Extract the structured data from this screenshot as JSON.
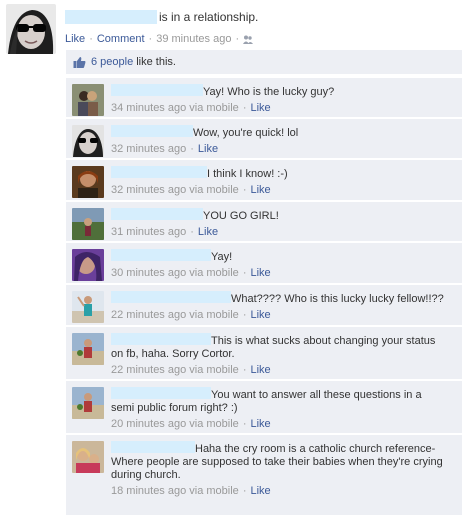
{
  "story": {
    "status_text": "is in a relationship.",
    "actions": {
      "like": "Like",
      "comment": "Comment",
      "time": "39 minutes ago"
    },
    "icons": {
      "avatar": "woman-in-sunglasses-avatar",
      "audience": "people-icon"
    },
    "likes": {
      "icon": "thumbs-up-icon",
      "count_label": "6 people",
      "suffix": "like this."
    }
  },
  "comments": [
    {
      "text": "Yay! Who is the lucky guy?",
      "time": "34 minutes ago",
      "via": "via mobile",
      "like": "Like",
      "mobile": true
    },
    {
      "text": "Wow, you're quick! lol",
      "time": "32 minutes ago",
      "via": "",
      "like": "Like",
      "mobile": false
    },
    {
      "text": "I think I know! :-)",
      "time": "32 minutes ago",
      "via": "via mobile",
      "like": "Like",
      "mobile": true
    },
    {
      "text": "YOU GO GIRL!",
      "time": "31 minutes ago",
      "via": "",
      "like": "Like",
      "mobile": false
    },
    {
      "text": "Yay!",
      "time": "30 minutes ago",
      "via": "via mobile",
      "like": "Like",
      "mobile": true
    },
    {
      "text": "What???? Who is this lucky lucky fellow!!??",
      "time": "22 minutes ago",
      "via": "via mobile",
      "like": "Like",
      "mobile": true
    },
    {
      "text_line1": "This is what sucks about changing your status",
      "text_line2": "on fb, haha. Sorry Cortor.",
      "time": "22 minutes ago",
      "via": "via mobile",
      "like": "Like",
      "mobile": true
    },
    {
      "text_line1": "You want to answer all these questions in a",
      "text_line2": "semi public forum right? :)",
      "time": "20 minutes ago",
      "via": "via mobile",
      "like": "Like",
      "mobile": true
    },
    {
      "text_line1": "Haha the cry room is a catholic church reference-",
      "text_line2": "Where people are supposed to take their babies when they're crying",
      "text_line3": "during church.",
      "time": "18 minutes ago",
      "via": "via mobile",
      "like": "Like",
      "mobile": true
    }
  ],
  "colors": {
    "link": "#3b5998",
    "meta": "#999999",
    "comment_bg": "#edeff4",
    "redaction": "#d6eefd"
  }
}
